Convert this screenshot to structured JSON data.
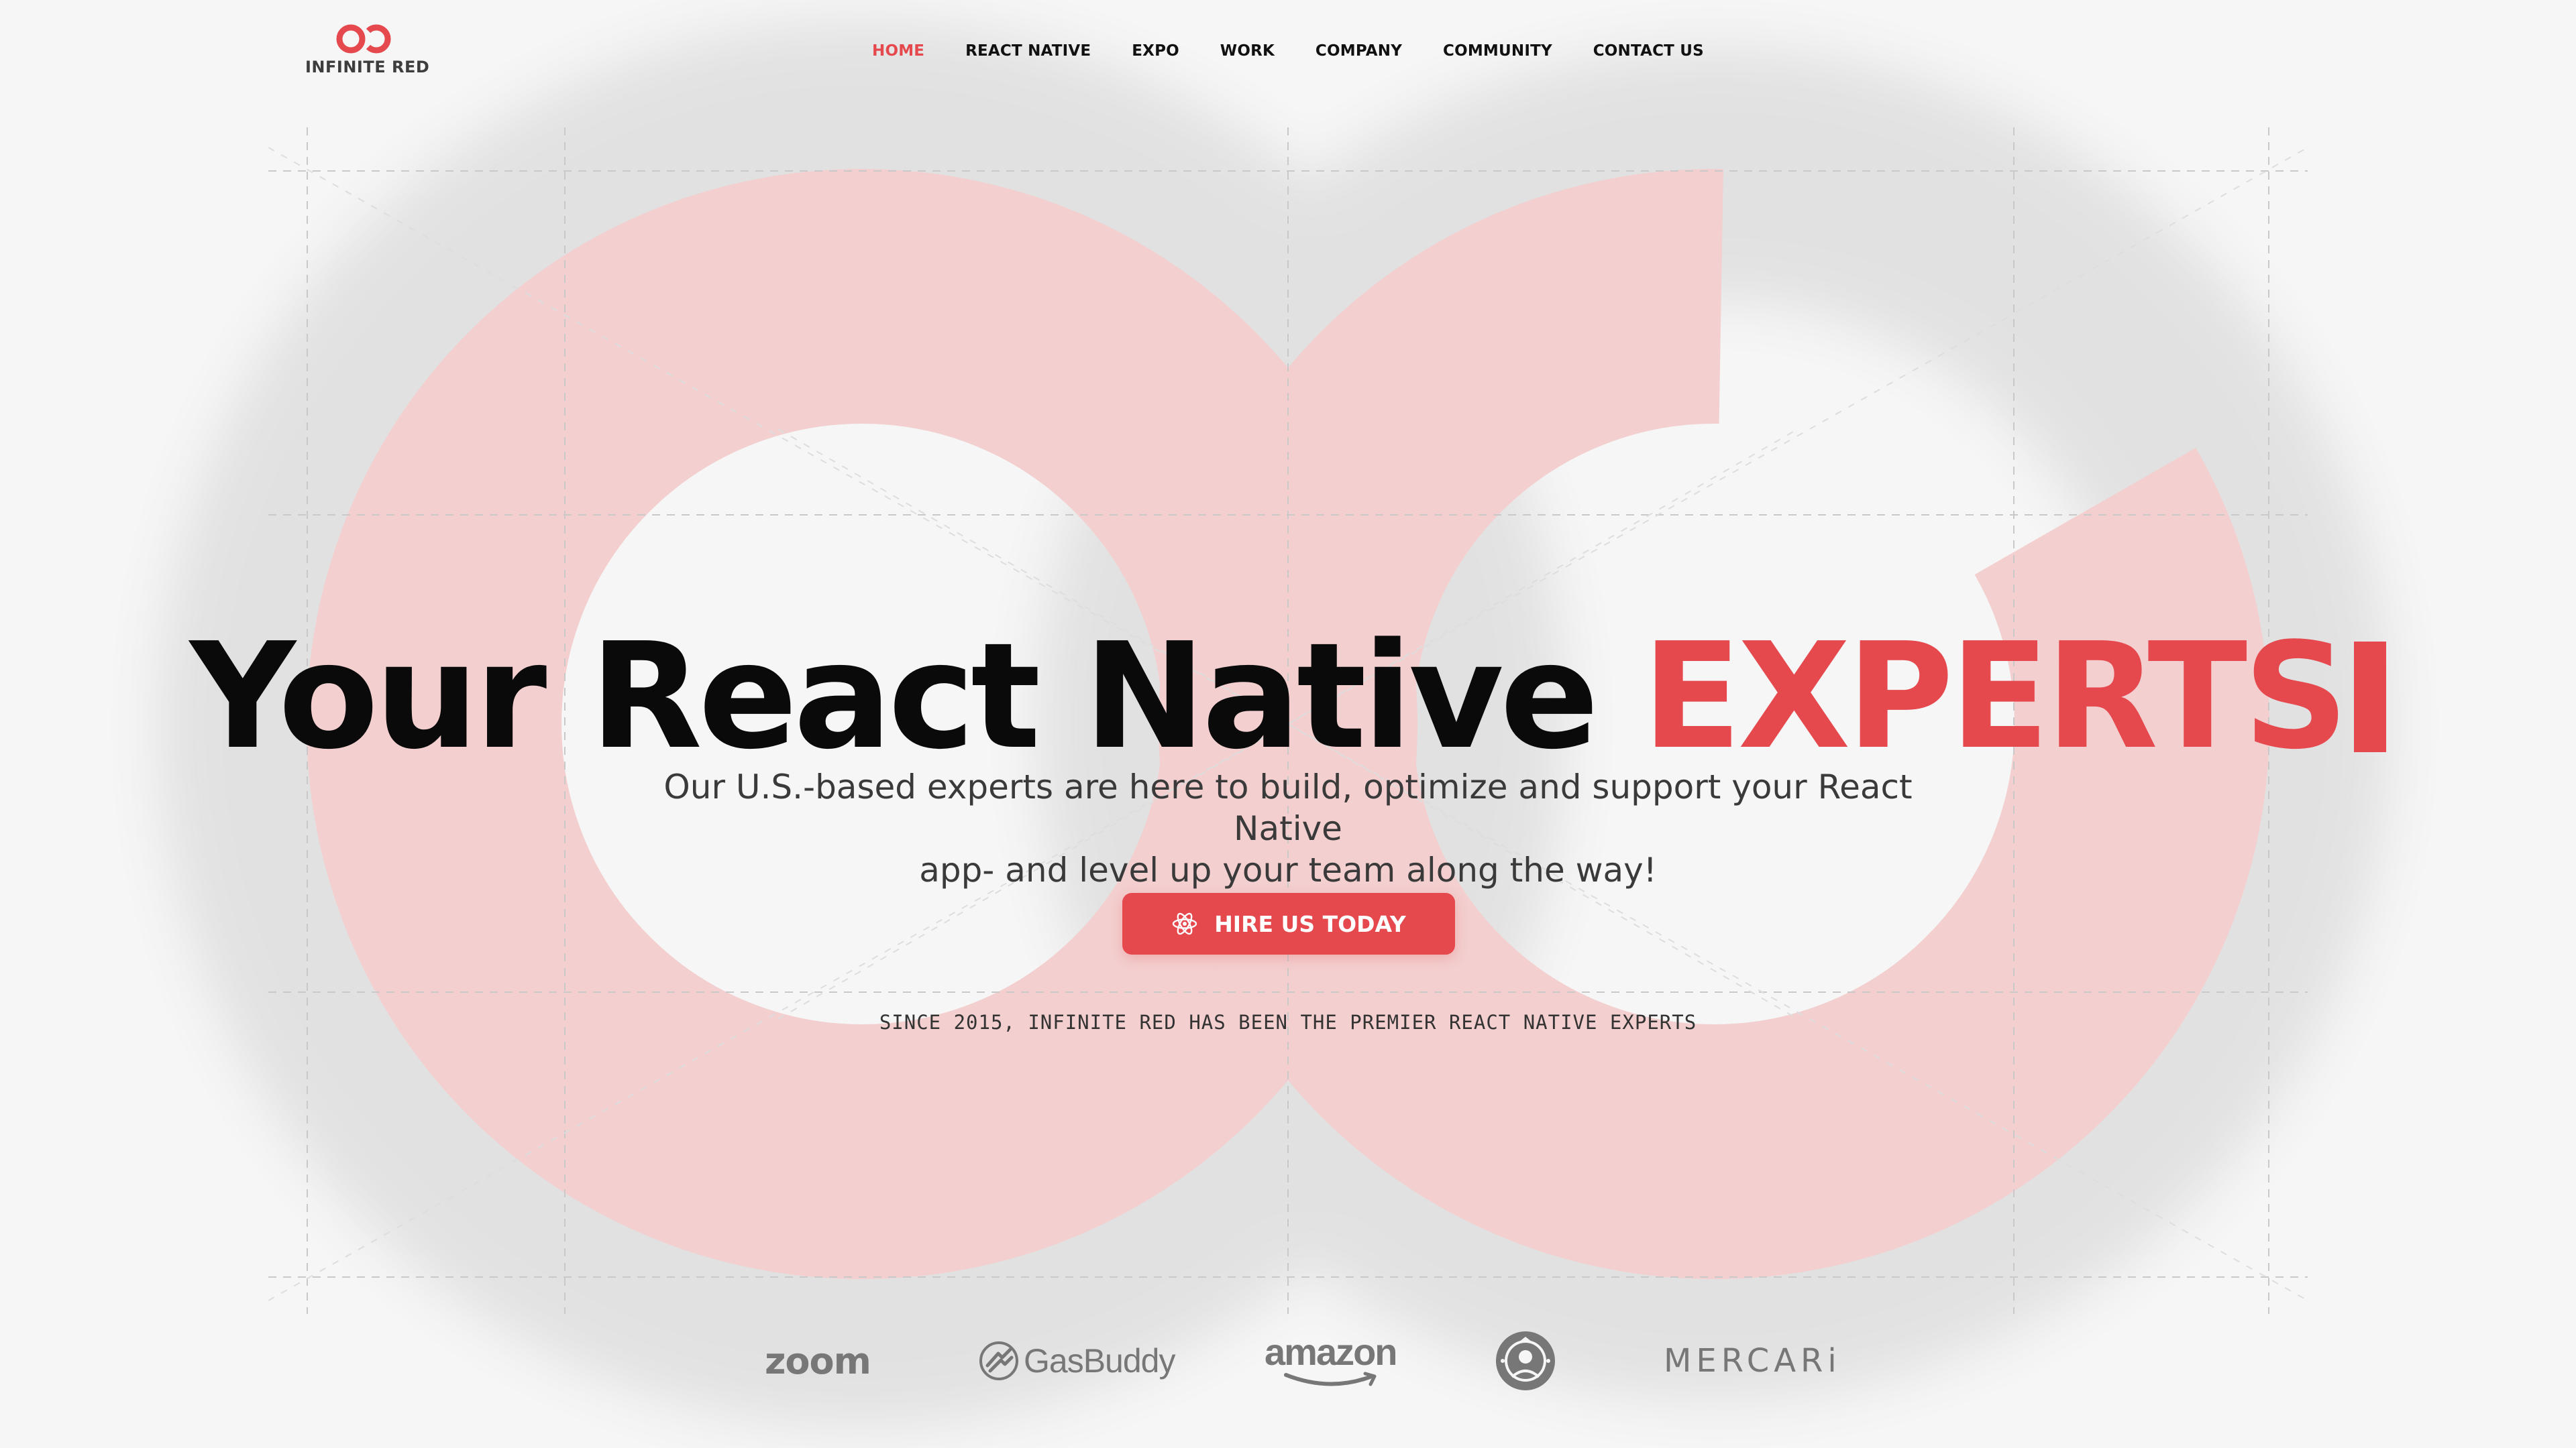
{
  "brand": {
    "name": "INFINITE RED",
    "accent_color": "#e5484d",
    "hero_shape_color": "#f3cfcf",
    "logo_icon": "infinite-red-logo-icon"
  },
  "nav": {
    "items": [
      {
        "label": "HOME",
        "active": true
      },
      {
        "label": "REACT NATIVE",
        "active": false
      },
      {
        "label": "EXPO",
        "active": false
      },
      {
        "label": "WORK",
        "active": false
      },
      {
        "label": "COMPANY",
        "active": false
      },
      {
        "label": "COMMUNITY",
        "active": false
      },
      {
        "label": "CONTACT US",
        "active": false
      }
    ]
  },
  "hero": {
    "headline_prefix": "Your React Native ",
    "headline_accent": "EXPERTS",
    "subtitle_line1": "Our U.S.-based experts are here to build, optimize and support your React Native",
    "subtitle_line2": "app- and level up your team along the way!",
    "cta_label": "HIRE US TODAY",
    "cta_icon": "react-atom-icon",
    "tagline": "SINCE 2015, INFINITE RED HAS BEEN THE PREMIER REACT NATIVE EXPERTS"
  },
  "clients": {
    "zoom": "zoom",
    "gasbuddy": "GasBuddy",
    "amazon": "amazon",
    "starbucks": "starbucks-logo",
    "mercari": "MERCARi"
  }
}
